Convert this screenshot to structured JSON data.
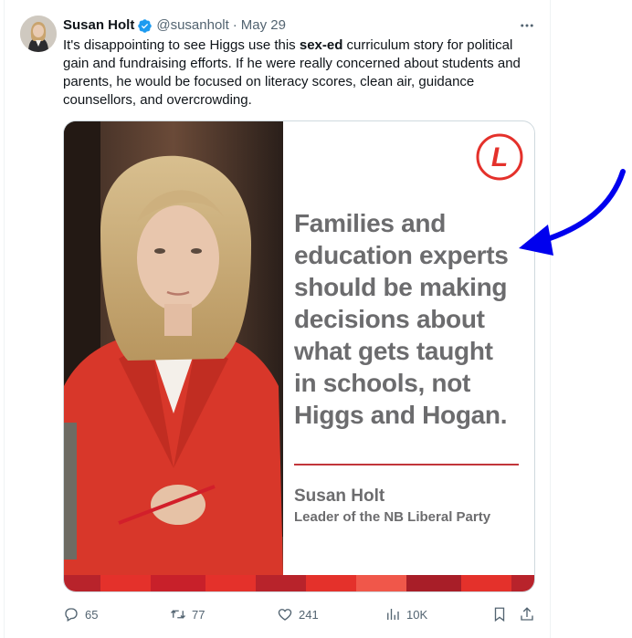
{
  "author": {
    "name": "Susan Holt",
    "handle": "@susanholt",
    "separator": "·",
    "date": "May 29"
  },
  "more_icon": "more-horizontal-icon",
  "verified_icon": "verified-badge-icon",
  "tweet_text": {
    "part1": "It's disappointing to see Higgs use this ",
    "bold": "sex-ed",
    "part2": " curriculum story for political gain and fundraising efforts. If he were really concerned about students and parents, he would be focused on literacy scores, clean air, guidance counsellors, and overcrowding."
  },
  "card": {
    "logo_letter": "L",
    "quote_lines": [
      "Families and",
      "education experts",
      "should be making",
      "decisions about",
      "what gets taught",
      "in schools, not",
      "Higgs and Hogan."
    ],
    "author_name": "Susan Holt",
    "author_title": "Leader of the NB Liberal Party",
    "colors": {
      "accent_red": "#e4312b",
      "rule_red": "#c2353a",
      "quote_gray": "#6c6c6e"
    }
  },
  "actions": {
    "replies": "65",
    "retweets": "77",
    "likes": "241",
    "views": "10K"
  },
  "icons": {
    "reply": "reply-icon",
    "retweet": "retweet-icon",
    "like": "heart-icon",
    "views": "views-icon",
    "bookmark": "bookmark-icon",
    "share": "share-icon"
  },
  "annotation": {
    "arrow_color": "#0000ee"
  }
}
